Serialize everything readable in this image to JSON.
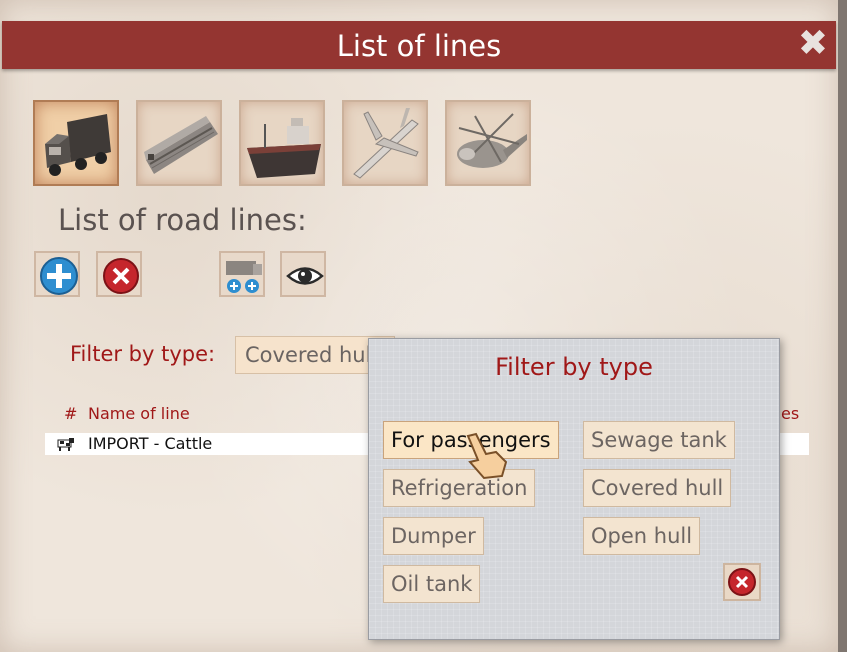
{
  "window": {
    "title": "List of lines",
    "close_label": "✖"
  },
  "vehicle_tabs": [
    {
      "name": "truck",
      "selected": true
    },
    {
      "name": "train",
      "selected": false
    },
    {
      "name": "ship",
      "selected": false
    },
    {
      "name": "plane",
      "selected": false
    },
    {
      "name": "helicopter",
      "selected": false
    }
  ],
  "section": {
    "title": "List of road lines:"
  },
  "toolbar": [
    "add-line-icon",
    "delete-line-icon",
    "add-vehicles-icon",
    "view-icon"
  ],
  "filter": {
    "label": "Filter by type:",
    "selected_value": "Covered hull"
  },
  "table": {
    "columns": {
      "number": "#",
      "name": "Name of line",
      "right_partial": "es"
    },
    "rows": [
      {
        "icon": "cow-icon",
        "name": "IMPORT - Cattle"
      }
    ]
  },
  "popup": {
    "title": "Filter by type",
    "options": {
      "passengers": "For passengers",
      "sewage": "Sewage tank",
      "refrigeration": "Refrigeration",
      "covered": "Covered hull",
      "dumper": "Dumper",
      "open": "Open hull",
      "oil": "Oil tank"
    },
    "hovered": "passengers"
  },
  "colors": {
    "title_bar": "#943531",
    "accent_red": "#a01818",
    "parchment": "#efe6dc"
  }
}
